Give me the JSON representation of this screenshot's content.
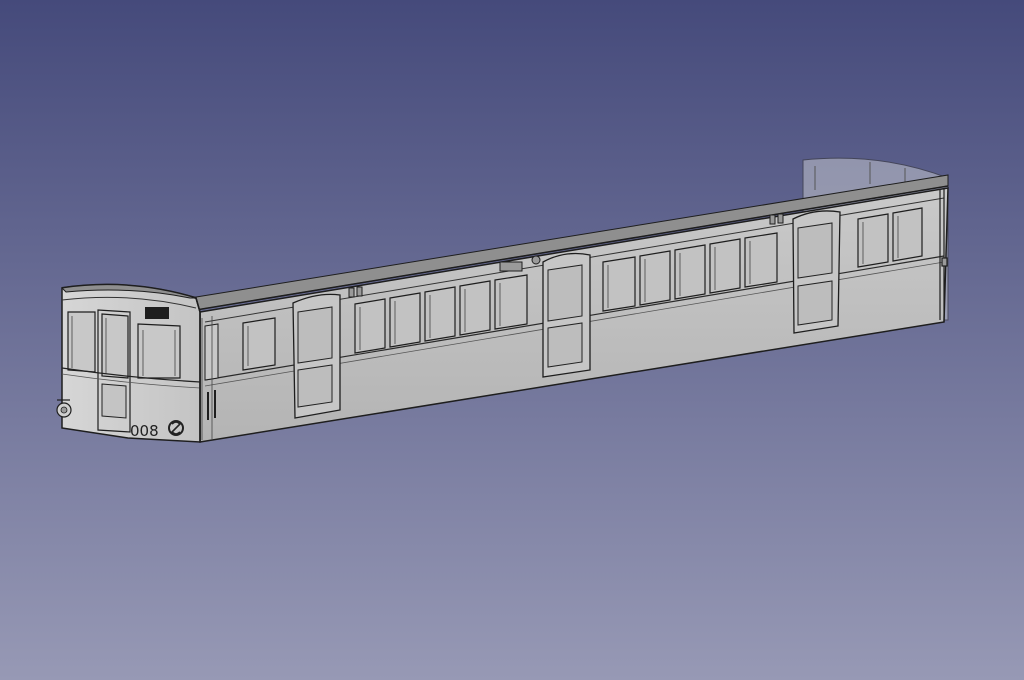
{
  "viewport": {
    "background_top": "#454a7b",
    "background_bottom": "#9799b5"
  },
  "model": {
    "car_number": "008",
    "body_color": "#bdbdbd",
    "roof_color": "#8f8f8f",
    "edge_color": "#1e1e1e"
  }
}
